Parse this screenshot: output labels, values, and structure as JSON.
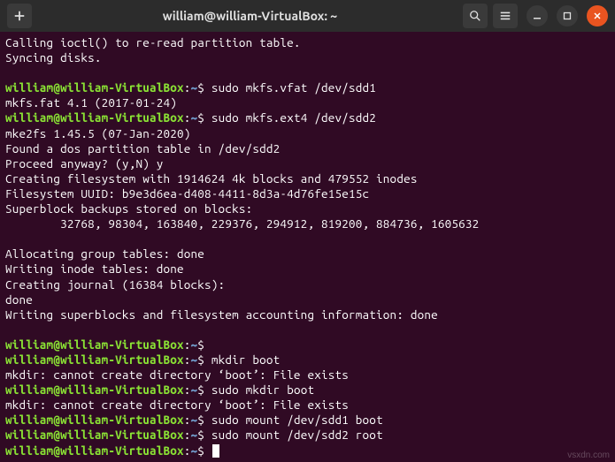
{
  "window": {
    "title": "william@william-VirtualBox: ~"
  },
  "prompt": {
    "userhost": "william@william-VirtualBox",
    "path": "~",
    "sep": ":",
    "sigil": "$"
  },
  "lines": [
    {
      "t": "out",
      "text": "Calling ioctl() to re-read partition table."
    },
    {
      "t": "out",
      "text": "Syncing disks."
    },
    {
      "t": "blank"
    },
    {
      "t": "prompt",
      "cmd": "sudo mkfs.vfat /dev/sdd1"
    },
    {
      "t": "out",
      "text": "mkfs.fat 4.1 (2017-01-24)"
    },
    {
      "t": "prompt",
      "cmd": "sudo mkfs.ext4 /dev/sdd2"
    },
    {
      "t": "out",
      "text": "mke2fs 1.45.5 (07-Jan-2020)"
    },
    {
      "t": "out",
      "text": "Found a dos partition table in /dev/sdd2"
    },
    {
      "t": "out",
      "text": "Proceed anyway? (y,N) y"
    },
    {
      "t": "out",
      "text": "Creating filesystem with 1914624 4k blocks and 479552 inodes"
    },
    {
      "t": "out",
      "text": "Filesystem UUID: b9e3d6ea-d408-4411-8d3a-4d76fe15e15c"
    },
    {
      "t": "out",
      "text": "Superblock backups stored on blocks:"
    },
    {
      "t": "out",
      "text": "        32768, 98304, 163840, 229376, 294912, 819200, 884736, 1605632"
    },
    {
      "t": "blank"
    },
    {
      "t": "out",
      "text": "Allocating group tables: done"
    },
    {
      "t": "out",
      "text": "Writing inode tables: done"
    },
    {
      "t": "out",
      "text": "Creating journal (16384 blocks):"
    },
    {
      "t": "out",
      "text": "done"
    },
    {
      "t": "out",
      "text": "Writing superblocks and filesystem accounting information: done"
    },
    {
      "t": "blank"
    },
    {
      "t": "prompt",
      "cmd": ""
    },
    {
      "t": "prompt",
      "cmd": "mkdir boot"
    },
    {
      "t": "out",
      "text": "mkdir: cannot create directory ‘boot’: File exists"
    },
    {
      "t": "prompt",
      "cmd": "sudo mkdir boot"
    },
    {
      "t": "out",
      "text": "mkdir: cannot create directory ‘boot’: File exists"
    },
    {
      "t": "prompt",
      "cmd": "sudo mount /dev/sdd1 boot"
    },
    {
      "t": "prompt",
      "cmd": "sudo mount /dev/sdd2 root"
    },
    {
      "t": "prompt",
      "cmd": "",
      "cursor": true
    }
  ],
  "watermark": "vsxdn.com"
}
